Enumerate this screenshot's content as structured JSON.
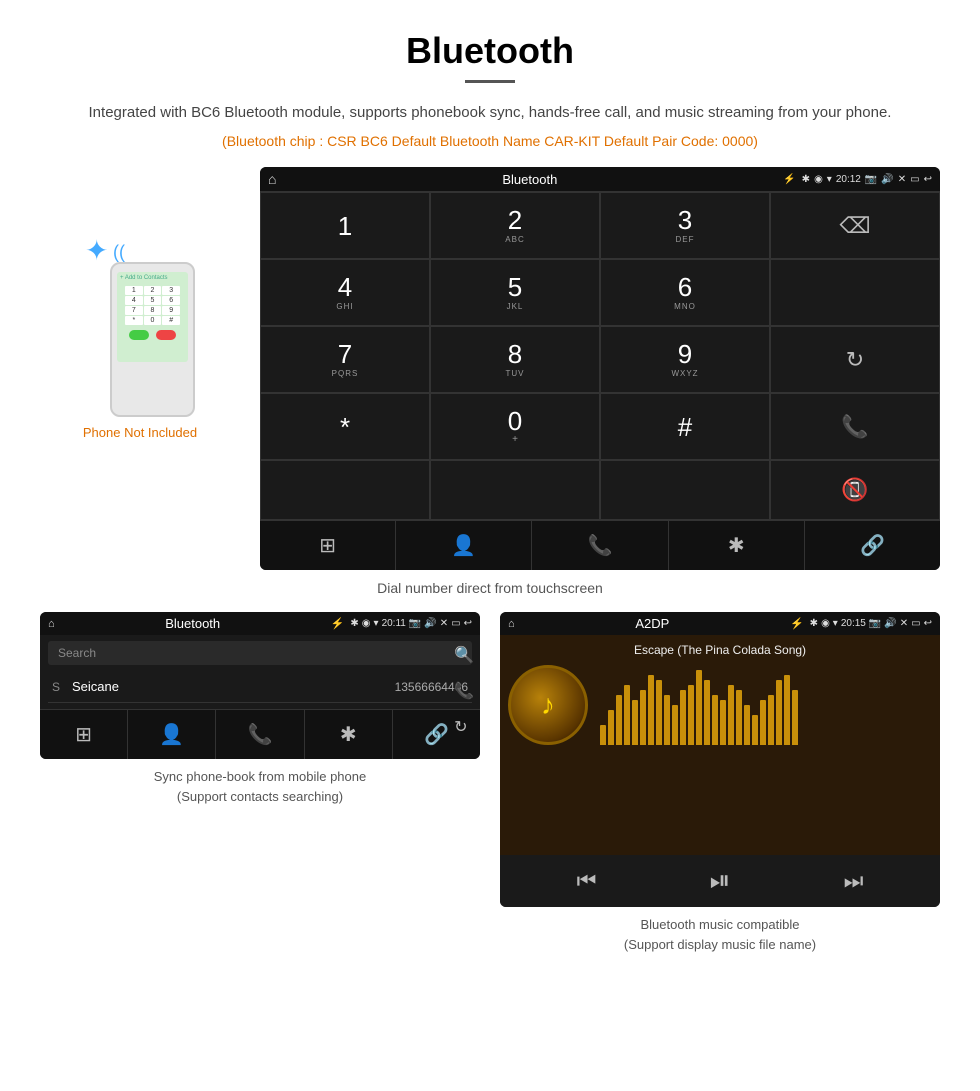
{
  "page": {
    "title": "Bluetooth",
    "description": "Integrated with BC6 Bluetooth module, supports phonebook sync, hands-free call, and music streaming from your phone.",
    "specs": "(Bluetooth chip : CSR BC6    Default Bluetooth Name CAR-KIT    Default Pair Code: 0000)",
    "dial_caption": "Dial number direct from touchscreen",
    "phonebook_caption": "Sync phone-book from mobile phone\n(Support contacts searching)",
    "music_caption": "Bluetooth music compatible\n(Support display music file name)",
    "phone_not_included": "Phone Not Included"
  },
  "dial_screen": {
    "status_bar": {
      "home": "⌂",
      "title": "Bluetooth",
      "usb": "⚡",
      "bt": "✱",
      "location": "◎",
      "wifi": "▾",
      "time": "20:12",
      "camera": "📷",
      "volume": "🔊",
      "close": "✕",
      "window": "▭",
      "back": "↩"
    },
    "keys": [
      {
        "num": "1",
        "sub": ""
      },
      {
        "num": "2",
        "sub": "ABC"
      },
      {
        "num": "3",
        "sub": "DEF"
      },
      {
        "num": "",
        "sub": "",
        "special": "backspace"
      },
      {
        "num": "4",
        "sub": "GHI"
      },
      {
        "num": "5",
        "sub": "JKL"
      },
      {
        "num": "6",
        "sub": "MNO"
      },
      {
        "num": "",
        "sub": "",
        "special": "empty"
      },
      {
        "num": "7",
        "sub": "PQRS"
      },
      {
        "num": "8",
        "sub": "TUV"
      },
      {
        "num": "9",
        "sub": "WXYZ"
      },
      {
        "num": "",
        "sub": "",
        "special": "refresh"
      },
      {
        "num": "*",
        "sub": ""
      },
      {
        "num": "0",
        "sub": "+"
      },
      {
        "num": "#",
        "sub": ""
      },
      {
        "num": "",
        "sub": "",
        "special": "call-green"
      },
      {
        "num": "",
        "sub": "",
        "special": "empty"
      },
      {
        "num": "",
        "sub": "",
        "special": "empty"
      },
      {
        "num": "",
        "sub": "",
        "special": "empty"
      },
      {
        "num": "",
        "sub": "",
        "special": "end-red"
      }
    ],
    "bottom_bar": [
      "⊞",
      "👤",
      "📞",
      "✱",
      "🔗"
    ]
  },
  "phonebook_screen": {
    "status_bar": {
      "title": "Bluetooth",
      "time": "20:11"
    },
    "search_placeholder": "Search",
    "contacts": [
      {
        "letter": "S",
        "name": "Seicane",
        "number": "13566664466"
      }
    ]
  },
  "music_screen": {
    "status_bar": {
      "title": "A2DP",
      "time": "20:15"
    },
    "song_title": "Escape (The Pina Colada Song)",
    "bar_heights": [
      20,
      35,
      50,
      60,
      45,
      55,
      70,
      65,
      50,
      40,
      55,
      60,
      75,
      65,
      50,
      45,
      60,
      55,
      40,
      30,
      45,
      50,
      65,
      70,
      55
    ],
    "controls": {
      "prev": "⏮",
      "play_pause": "⏯",
      "next": "⏭"
    }
  }
}
